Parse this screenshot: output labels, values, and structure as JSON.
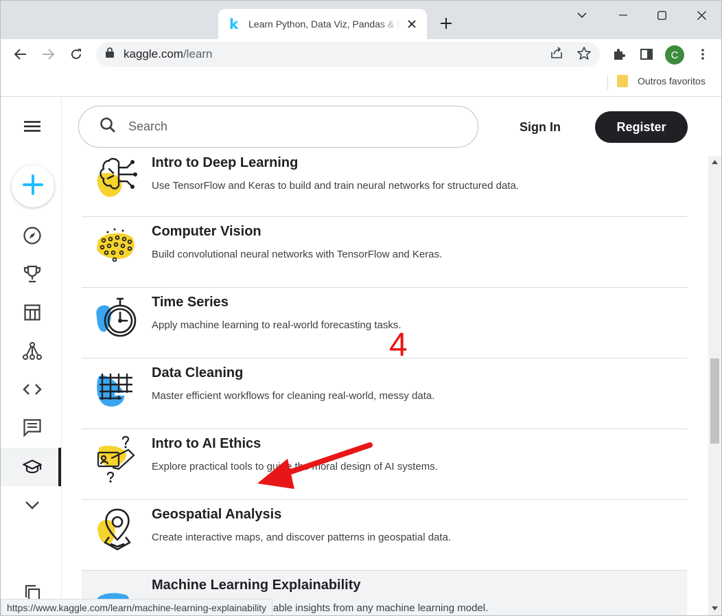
{
  "browser": {
    "tab": {
      "title": "Learn Python, Data Viz, Pandas & More | Tutorials | Kaggle",
      "favicon": "k"
    },
    "url": {
      "host": "kaggle.com",
      "path": "/learn"
    },
    "bookmarks": {
      "folder_label": "Outros favoritos"
    },
    "profile_initial": "C",
    "status_url": "https://www.kaggle.com/learn/machine-learning-explainability"
  },
  "header": {
    "search_placeholder": "Search",
    "signin_label": "Sign In",
    "register_label": "Register"
  },
  "sidenav": {
    "items": [
      "compass-icon",
      "trophy-icon",
      "table-icon",
      "graph-icon",
      "code-icon",
      "comment-icon",
      "school-icon",
      "chevron-down-icon",
      "copy-icon"
    ],
    "active": "school-icon"
  },
  "courses": [
    {
      "title": "Intro to Deep Learning",
      "desc": "Use TensorFlow and Keras to build and train neural networks for structured data.",
      "blob": "#f6d32d"
    },
    {
      "title": "Computer Vision",
      "desc": "Build convolutional neural networks with TensorFlow and Keras.",
      "blob": "#f6d32d"
    },
    {
      "title": "Time Series",
      "desc": "Apply machine learning to real-world forecasting tasks.",
      "blob": "#3aa6f0"
    },
    {
      "title": "Data Cleaning",
      "desc": "Master efficient workflows for cleaning real-world, messy data.",
      "blob": "#3aa6f0"
    },
    {
      "title": "Intro to AI Ethics",
      "desc": "Explore practical tools to guide the moral design of AI systems.",
      "blob": "#f6d32d"
    },
    {
      "title": "Geospatial Analysis",
      "desc": "Create interactive maps, and discover patterns in geospatial data.",
      "blob": "#f6d32d"
    },
    {
      "title": "Machine Learning Explainability",
      "desc": "Extract human-understandable insights from any machine learning model.",
      "blob": "#3aa6f0"
    }
  ],
  "annotation": {
    "number": "4",
    "color": "#e81616"
  }
}
